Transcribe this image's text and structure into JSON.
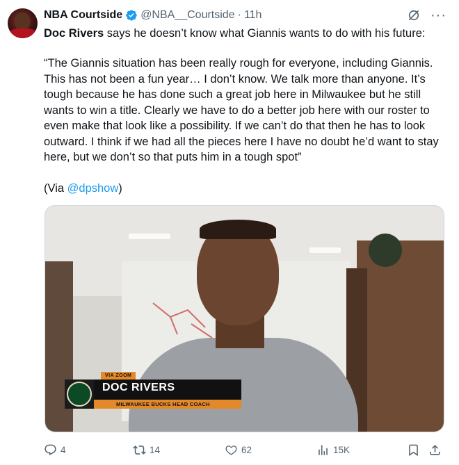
{
  "tweet": {
    "author_name": "NBA Courtside",
    "handle": "@NBA__Courtside",
    "separator": "·",
    "time": "11h",
    "intro_bold": "Doc Rivers",
    "intro_rest": " says he doesn’t know what Giannis wants to do with his future:",
    "quote": "“The Giannis situation has been really rough for everyone, including Giannis. This has not been a fun year… I don’t know. We talk more than anyone. It’s tough because he has done such a great job here in Milwaukee but he still wants to win a title. Clearly we have to do a better job here with our roster to even make that look like a possibility. If we can’t do that then he has to look outward. I think if we had all the pieces here I have no doubt he’d want to stay here, but we don’t so that puts him in a tough spot”",
    "via_prefix": "(Via ",
    "via_link": "@dpshow",
    "via_suffix": ")"
  },
  "media": {
    "lower_third_tag": "VIA ZOOM",
    "lower_third_name": "DOC RIVERS",
    "lower_third_title": "MILWAUKEE BUCKS HEAD COACH"
  },
  "metrics": {
    "replies": "4",
    "reposts": "14",
    "likes": "62",
    "views": "15K"
  },
  "colors": {
    "verified": "#1d9bf0",
    "link": "#1d9bf0",
    "muted": "#536471"
  }
}
